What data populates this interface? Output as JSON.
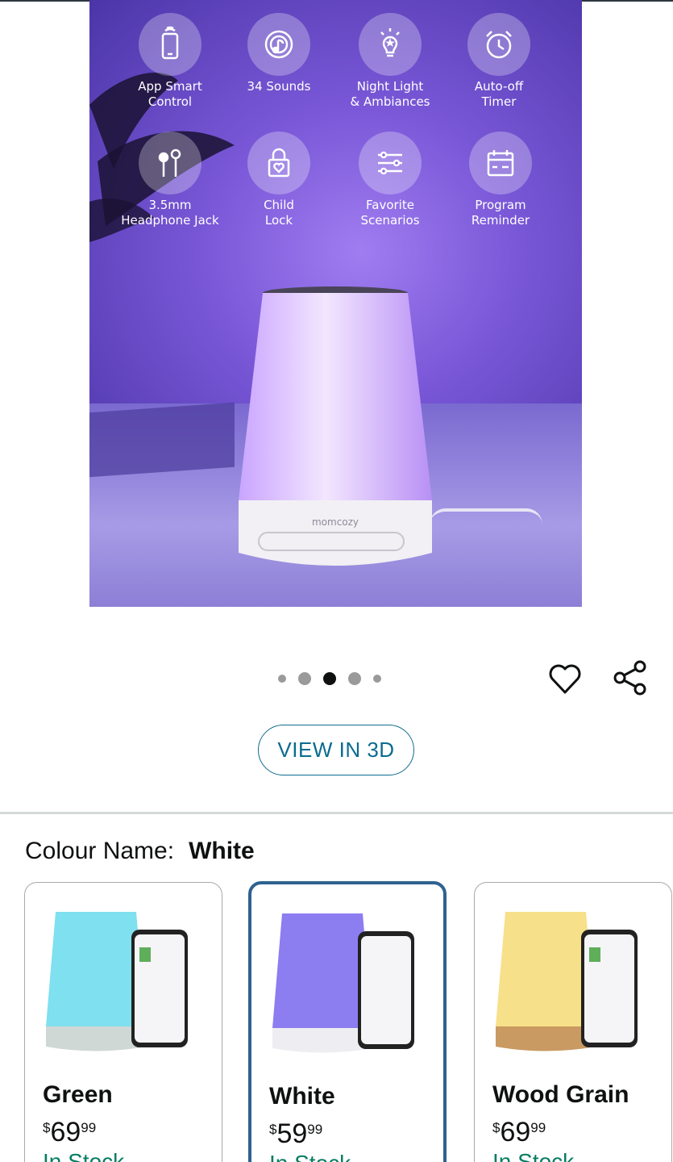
{
  "hero": {
    "features": [
      {
        "label": "App Smart\nControl",
        "icon": "phone-icon"
      },
      {
        "label": "34 Sounds",
        "icon": "music-note-icon"
      },
      {
        "label": "Night Light\n& Ambiances",
        "icon": "light-bulb-icon"
      },
      {
        "label": "Auto-off\nTimer",
        "icon": "alarm-clock-icon"
      },
      {
        "label": "3.5mm\nHeadphone Jack",
        "icon": "earphones-icon"
      },
      {
        "label": "Child\nLock",
        "icon": "lock-heart-icon"
      },
      {
        "label": "Favorite\nScenarios",
        "icon": "sliders-icon"
      },
      {
        "label": "Program\nReminder",
        "icon": "calendar-icon"
      }
    ],
    "brand": "momcozy"
  },
  "carousel": {
    "count": 5,
    "active_index": 2
  },
  "actions": {
    "heart_icon": "heart-icon",
    "share_icon": "share-icon"
  },
  "view3d": {
    "label": "VIEW IN 3D"
  },
  "colour": {
    "label": "Colour Name:",
    "value": "White"
  },
  "variants": [
    {
      "name": "Green",
      "price_dollars": "69",
      "price_cents": "99",
      "currency": "$",
      "stock": "In Stock",
      "glow": "#7fe0ef",
      "selected": false
    },
    {
      "name": "White",
      "price_dollars": "59",
      "price_cents": "99",
      "currency": "$",
      "stock": "In Stock",
      "glow": "#8c7df0",
      "selected": true
    },
    {
      "name": "Wood Grain",
      "price_dollars": "69",
      "price_cents": "99",
      "currency": "$",
      "stock": "In Stock",
      "glow": "#f7e08a",
      "selected": false
    }
  ],
  "colors": {
    "accent_blue": "#2e6290",
    "link_blue": "#0b6b90",
    "stock_green": "#067d62"
  }
}
